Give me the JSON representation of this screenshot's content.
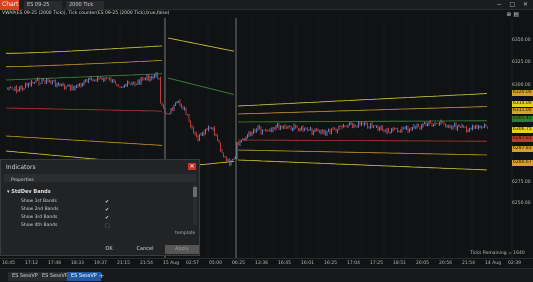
{
  "titlebar": {
    "chart_tab": "Chart",
    "instrument": "ES 09-25",
    "interval": "2000 Tick",
    "window_controls": "− □ ✕"
  },
  "toolbar": {
    "indicator_label": "VWAP(ES 09-25 (2000 Tick)), Tick counter(ES 09-25 (2000 Tick),true,false)",
    "icons": "⊕ ▤"
  },
  "yaxis": {
    "labels": [
      "6350.00",
      "6325.00",
      "6300.00",
      "6275.00",
      "6250.00"
    ],
    "price_tags": [
      {
        "text": "6320.00",
        "color": "#d9a21e"
      },
      {
        "text": "6314.00",
        "color": "#e6d21c"
      },
      {
        "text": "6311.00",
        "color": "#d9a21e"
      },
      {
        "text": "6301.42",
        "color": "#2f7c32"
      },
      {
        "text": "6306.75",
        "color": "#e6d21c"
      },
      {
        "text": "6287.81",
        "color": "#c0382b"
      },
      {
        "text": "6287.83",
        "color": "#d9a21e"
      },
      {
        "text": "6280.67",
        "color": "#d9a21e"
      }
    ]
  },
  "xaxis": {
    "ticks": [
      "16:45",
      "17:12",
      "17:48",
      "18:33",
      "19:37",
      "21:15",
      "21:54",
      "15 Aug",
      "02:57",
      "05:00",
      "06:25",
      "13:36",
      "16:45",
      "16:01",
      "16:25",
      "17:04",
      "17:25",
      "18:51",
      "20:05",
      "20:56",
      "21:54",
      "14 Aug",
      "02:39"
    ],
    "status": "Ticks Remaining = 1640"
  },
  "bottom_tabs": {
    "tabs": [
      "ES SessVP",
      "ES SessVP",
      "ES SessVP"
    ],
    "add": "+"
  },
  "dialog": {
    "title": "Indicators",
    "close": "✕",
    "properties": "Properties",
    "section": "StdDev Bands",
    "section_toggle": "▾",
    "rows": [
      {
        "label": "Show 1st Bands",
        "checked": "✔"
      },
      {
        "label": "Show 2nd Bands",
        "checked": "✔"
      },
      {
        "label": "Show 3rd Bands",
        "checked": "✔"
      },
      {
        "label": "Show 4th Bands",
        "checked": "□"
      }
    ],
    "template": "template",
    "ok": "OK",
    "cancel": "Cancel",
    "apply": "Apply"
  },
  "colors": {
    "background": "#111213",
    "accent": "#d9421e",
    "candles_up": "#6f86c9",
    "candles_down": "#c9423f",
    "band_yellow": "#d8cf3a",
    "band_orange": "#c99a2a",
    "band_green": "#3c8f3c",
    "vwap_red": "#b33a32"
  }
}
